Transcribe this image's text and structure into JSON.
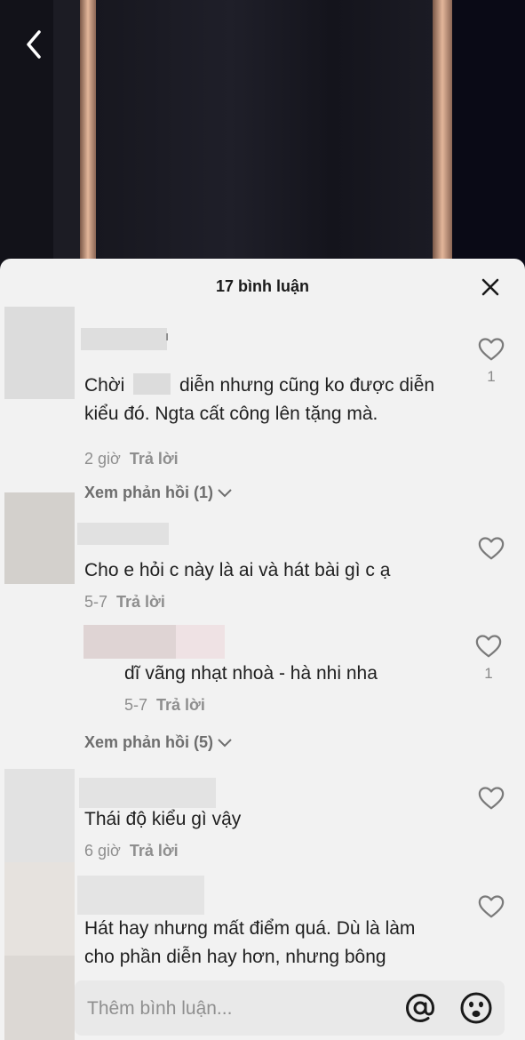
{
  "header": {
    "title": "17 bình luận"
  },
  "comments": [
    {
      "name_suffix": "ı",
      "text_line1_prefix": "Chời",
      "text_line1_suffix": "diễn nhưng cũng ko được diễn",
      "text_line2": "kiểu đó. Ngta cất công lên tặng mà.",
      "time": "2 giờ",
      "reply_label": "Trả lời",
      "likes": "1",
      "view_replies": "Xem phản hồi (1)"
    },
    {
      "text": "Cho e hỏi c này là ai và hát bài gì c ạ",
      "time": "5-7",
      "reply_label": "Trả lời",
      "view_replies": "Xem phản hồi (5)",
      "reply": {
        "text": "dĩ vãng nhạt nhoà - hà nhi nha",
        "time": "5-7",
        "reply_label": "Trả lời",
        "likes": "1"
      }
    },
    {
      "text": "Thái độ kiểu gì vậy",
      "time": "6 giờ",
      "reply_label": "Trả lời"
    },
    {
      "text_line1": "Hát hay nhưng mất điểm quá. Dù là làm",
      "text_line2": "cho phần diễn hay hơn, nhưng bông"
    }
  ],
  "input": {
    "placeholder": "Thêm bình luận..."
  },
  "colors": {
    "sheet_bg": "#f2f2f2",
    "text": "#1f1f1f",
    "muted": "#8e8e8e"
  },
  "icons": [
    "back-icon",
    "close-icon",
    "heart-icon",
    "chevron-down-icon",
    "at-icon",
    "emoji-icon"
  ]
}
